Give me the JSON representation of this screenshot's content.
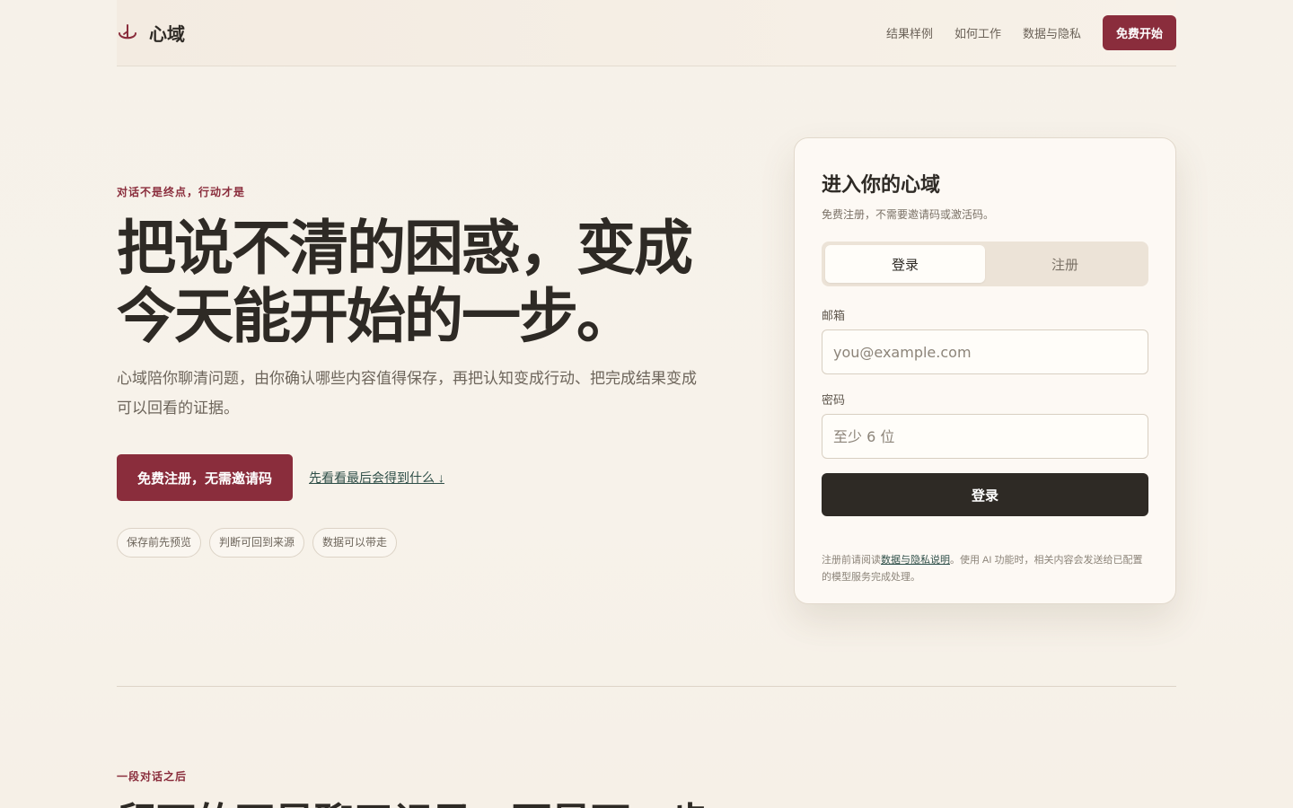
{
  "header": {
    "brand": "心域",
    "nav": [
      "结果样例",
      "如何工作",
      "数据与隐私"
    ],
    "cta": "免费开始"
  },
  "hero": {
    "eyebrow": "对话不是终点，行动才是",
    "title_line1": "把说不清的困惑，变成",
    "title_line2": "今天能开始的一步。",
    "description": "心域陪你聊清问题，由你确认哪些内容值得保存，再把认知变成行动、把完成结果变成可以回看的证据。",
    "primary_button": "免费注册，无需邀请码",
    "secondary_link": "先看看最后会得到什么 ↓",
    "chips": [
      "保存前先预览",
      "判断可回到来源",
      "数据可以带走"
    ]
  },
  "login_card": {
    "title": "进入你的心域",
    "subtitle": "免费注册，不需要邀请码或激活码。",
    "tabs": [
      "登录",
      "注册"
    ],
    "active_tab": "登录",
    "email_label": "邮箱",
    "email_placeholder": "you@example.com",
    "password_label": "密码",
    "password_placeholder": "至少 6 位",
    "submit": "登录",
    "note_prefix": "注册前请阅读",
    "note_link": "数据与隐私说明",
    "note_suffix": "。使用 AI 功能时，相关内容会发送给已配置的模型服务完成处理。"
  },
  "section2": {
    "eyebrow": "一段对话之后",
    "title": "留下的不是聊天记录，而是下一步"
  },
  "colors": {
    "brand_red": "#8a2d3c",
    "dark": "#2e2a25",
    "link_green": "#2f4f48",
    "background": "#f6f1e9"
  }
}
